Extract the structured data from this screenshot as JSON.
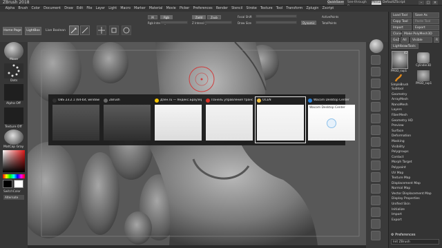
{
  "window": {
    "title": "ZBrush 2018",
    "quicksave": "QuickSave",
    "seethrough": "See-through 0",
    "menus": "Menus",
    "default_script": "DefaultZScript"
  },
  "menubar": [
    "Alpha",
    "Brush",
    "Color",
    "Document",
    "Draw",
    "Edit",
    "File",
    "Layer",
    "Light",
    "Macro",
    "Marker",
    "Material",
    "Movie",
    "Picker",
    "Preferences",
    "Render",
    "Stencil",
    "Stroke",
    "Texture",
    "Tool",
    "Transform",
    "Zplugin",
    "Zscript"
  ],
  "shelf": {
    "home_page": "Home Page",
    "lightbox": "LightBox",
    "live_boolean": "Live Boolean",
    "edit": "Edit",
    "draw": "Draw",
    "rgb": "Rgb",
    "m": "M",
    "zadd": "Zadd",
    "zsub": "Zsub",
    "rgb_intensity": "Rgb Intensity",
    "z_intensity": "Z Intensity",
    "focal_shift": "Focal Shift",
    "draw_size": "Draw Size",
    "dynamic": "Dynamic",
    "active_points": "ActivePoints",
    "total_points": "TotalPoints"
  },
  "left_tray": {
    "brush_label": "Move",
    "stroke_label": "Dots",
    "alpha_label": "Alpha Off",
    "texture_label": "Texture Off",
    "material_label": "MatCap Gray",
    "switch_color": "SwitchColor",
    "alternate": "Alternate"
  },
  "right_palette": {
    "buttons": [
      [
        "Load Tool",
        "Save As"
      ],
      [
        "Copy Tool",
        "Paste Tool"
      ],
      [
        "Import",
        "Export"
      ],
      [
        "Clone",
        "Make PolyMesh3D"
      ],
      [
        "GoZ",
        "All",
        "Visible",
        "R"
      ]
    ],
    "lightbox_tools": "Lightbox▸Tools",
    "tool_thumbs": [
      {
        "name": "PM3D_sup1",
        "count": "42"
      },
      {
        "name": "Cylinder3D",
        "count": ""
      },
      {
        "name": "SimpleBrush",
        "count": ""
      },
      {
        "name": "PM3D_sup1",
        "count": ""
      }
    ],
    "subtool_list": [
      "Subtool",
      "Geometry",
      "ArrayMesh",
      "NanoMesh",
      "Layers",
      "FiberMesh",
      "Geometry HD",
      "Preview",
      "Surface",
      "Deformation",
      "Masking",
      "Visibility",
      "Polygroups",
      "Contact",
      "Morph Target",
      "Polypaint",
      "UV Map",
      "Texture Map",
      "Displacement Map",
      "Normal Map",
      "Vector Displacement Map",
      "Display Properties",
      "Unified Skin",
      "Initialize",
      "Import",
      "Export"
    ],
    "preferences": "Preferences",
    "footer": "Init ZBrush"
  },
  "task_switcher": [
    {
      "title": "OBS 23.2.1 (64-bit, windows)...",
      "icon_color": "#303030"
    },
    {
      "title": "ZBrush",
      "icon_color": "#6a6a6a"
    },
    {
      "title": "Дзен.ru — Яндекс.Браузер",
      "icon_color": "#f2c200"
    },
    {
      "title": "Панель управления трансл...",
      "icon_color": "#d93025"
    },
    {
      "title": "OCEN",
      "icon_color": "#f0c040"
    },
    {
      "title": "Wacom Desktop Center",
      "icon_color": "#2a7fd4"
    }
  ],
  "wacom_preview_text": "Wacom Desktop Center"
}
